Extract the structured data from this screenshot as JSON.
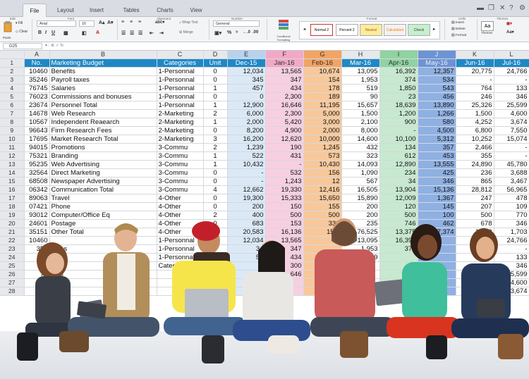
{
  "ribbon": {
    "tabs": [
      "File",
      "Layout",
      "Insert",
      "Tables",
      "Charts",
      "View"
    ],
    "active_tab": "File",
    "group_labels": [
      "Edit",
      "Font",
      "Alignment",
      "Number",
      "Format",
      "Cells",
      "Themes"
    ],
    "font_name": "Arial",
    "font_size": "16",
    "wrap_text": "Wrap Text",
    "merge": "Merge",
    "number_format": "General",
    "paste_label": "Paste",
    "fill_label": "Fill",
    "clear_label": "Clear",
    "conditional_formatting": "Conditional Formatting",
    "cell_styles": [
      "Normal 2",
      "Percent 2",
      "Neutral",
      "Calculation",
      "Check"
    ],
    "cells_buttons": [
      "Insert",
      "Delete",
      "Format"
    ],
    "themes_label": "Themes",
    "themes_sample": "Aa"
  },
  "formula_bar": {
    "name_box": "G25",
    "fx": "fx"
  },
  "grid": {
    "columns": [
      "A",
      "B",
      "C",
      "D",
      "E",
      "F",
      "G",
      "H",
      "I",
      "J",
      "K",
      "L"
    ],
    "header_row": [
      "No.",
      "Marketing Budget",
      "Categories",
      "Unit",
      "Dec-15",
      "Jan-16",
      "Feb-16",
      "Mar-16",
      "Apr-16",
      "May-16",
      "Jun-16",
      "Jul-16"
    ],
    "rows": [
      [
        "10460",
        "Benefits",
        "1-Personnal",
        "0",
        "12,034",
        "13,565",
        "10,674",
        "13,095",
        "16,392",
        "12,357",
        "20,775",
        "24,766"
      ],
      [
        "35246",
        "Payroll taxes",
        "1-Personnal",
        "0",
        "345",
        "347",
        "154",
        "1,953",
        "374",
        "534",
        "-",
        "-"
      ],
      [
        "76745",
        "Salaries",
        "1-Personnal",
        "1",
        "457",
        "434",
        "178",
        "519",
        "1,850",
        "543",
        "764",
        "133"
      ],
      [
        "76023",
        "Commissions and bonuses",
        "1-Personnal",
        "0",
        "0",
        "2,300",
        "189",
        "90",
        "23",
        "456",
        "246",
        "346"
      ],
      [
        "23674",
        "Personnel Total",
        "1-Personnal",
        "1",
        "12,900",
        "16,646",
        "11,195",
        "15,657",
        "18,639",
        "13,890",
        "25,326",
        "25,599"
      ],
      [
        "14678",
        "Web Research",
        "2-Marketing",
        "2",
        "6,000",
        "2,300",
        "5,000",
        "1,500",
        "1,200",
        "1,266",
        "1,500",
        "4,600"
      ],
      [
        "10567",
        "Independent Reaearch",
        "2-Marketing",
        "1",
        "2,000",
        "5,420",
        "3,000",
        "2,100",
        "900",
        "580",
        "4,252",
        "3,674"
      ],
      [
        "96643",
        "Firm Research Fees",
        "2-Marketing",
        "0",
        "8,200",
        "4,900",
        "2,000",
        "8,000",
        "-",
        "4,500",
        "6,800",
        "7,550"
      ],
      [
        "17695",
        "Market Research Total",
        "2-Marketing",
        "3",
        "16,200",
        "12,620",
        "10,000",
        "14,600",
        "10,100",
        "5,312",
        "10,252",
        "15,074"
      ],
      [
        "94015",
        "Promotions",
        "3-Commu",
        "2",
        "1,239",
        "190",
        "1,245",
        "432",
        "134",
        "357",
        "2,466",
        "-"
      ],
      [
        "75321",
        "Branding",
        "3-Commu",
        "1",
        "522",
        "431",
        "573",
        "323",
        "612",
        "453",
        "355",
        "-"
      ],
      [
        "95235",
        "Web Advertising",
        "3-Commu",
        "1",
        "10,432",
        "-",
        "10,430",
        "14,093",
        "12,890",
        "13,555",
        "24,890",
        "45,780"
      ],
      [
        "32564",
        "Direct Marketing",
        "3-Commu",
        "0",
        "-",
        "532",
        "156",
        "1,090",
        "234",
        "425",
        "236",
        "3,688"
      ],
      [
        "68508",
        "Newspaper Advertising",
        "3-Commu",
        "0",
        "-",
        "1,243",
        "12",
        "567",
        "34",
        "346",
        "865",
        "3,467"
      ],
      [
        "06342",
        "Communication Total",
        "3-Commu",
        "4",
        "12,662",
        "19,330",
        "12,416",
        "16,505",
        "13,904",
        "15,136",
        "28,812",
        "56,965"
      ],
      [
        "89063",
        "Travel",
        "4-Other",
        "0",
        "19,300",
        "15,333",
        "15,650",
        "15,890",
        "12,009",
        "1,367",
        "247",
        "478"
      ],
      [
        "07421",
        "Phone",
        "4-Other",
        "0",
        "200",
        "150",
        "155",
        "200",
        "120",
        "145",
        "207",
        "109"
      ],
      [
        "93012",
        "Computer/Office Eq",
        "4-Other",
        "2",
        "400",
        "500",
        "500",
        "200",
        "500",
        "100",
        "500",
        "770"
      ],
      [
        "24601",
        "Postage",
        "4-Other",
        "0",
        "683",
        "153",
        "330",
        "235",
        "746",
        "462",
        "678",
        "346"
      ],
      [
        "35151",
        "Other Total",
        "4-Other",
        "0",
        "20,583",
        "16,136",
        "15,6",
        "76,525",
        "13,375",
        "17,374",
        "1,623",
        "1,703"
      ],
      [
        "10460",
        "",
        "1-Personnal",
        "0",
        "12,034",
        "13,565",
        "",
        "13,095",
        "16,392",
        "",
        "",
        "24,766"
      ],
      [
        "352",
        "taxes",
        "1-Personnal",
        "",
        "34",
        "347",
        "",
        "1,953",
        "374",
        "",
        "",
        "-"
      ],
      [
        "",
        "",
        "1-Personnal",
        "",
        "52",
        "434",
        "",
        "519",
        "",
        "",
        "",
        "133"
      ],
      [
        "",
        "",
        "Categories",
        "",
        "",
        "300",
        "",
        "",
        "",
        "",
        "",
        "346"
      ],
      [
        "76",
        "ions",
        "",
        "",
        "",
        "646",
        "",
        "",
        "",
        "",
        "",
        "25,599"
      ],
      [
        "",
        "",
        "",
        "",
        "",
        "",
        "",
        "",
        "",
        "",
        "",
        "4,600"
      ],
      [
        "",
        "",
        "",
        "",
        "",
        "",
        "",
        "",
        "",
        "",
        "",
        "3,674"
      ]
    ]
  }
}
